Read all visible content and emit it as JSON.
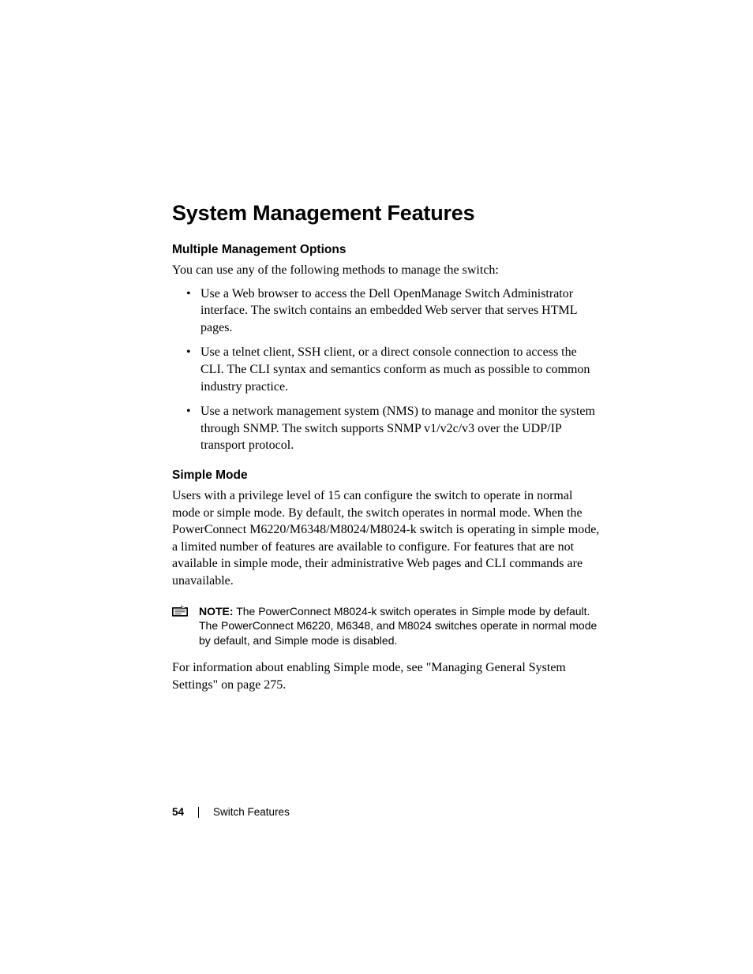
{
  "heading": "System Management Features",
  "section1": {
    "title": "Multiple Management Options",
    "intro": "You can use any of the following methods to manage the switch:",
    "bullets": [
      "Use a Web browser to access the Dell OpenManage Switch Administrator interface. The switch contains an embedded Web server that serves HTML pages.",
      "Use a telnet client, SSH client, or a direct console connection to access the CLI. The CLI syntax and semantics conform as much as possible to common industry practice.",
      "Use a network management system (NMS) to manage and monitor the system through SNMP. The switch supports SNMP v1/v2c/v3 over the UDP/IP transport protocol."
    ]
  },
  "section2": {
    "title": "Simple Mode",
    "body": "Users with a privilege level of 15 can configure the switch to operate in normal mode or simple mode. By default, the switch operates in normal mode. When the PowerConnect M6220/M6348/M8024/M8024-k switch is operating in simple mode, a limited number of features are available to configure. For features that are not available in simple mode, their administrative Web pages and CLI commands are unavailable.",
    "note_label": "NOTE:",
    "note_text": " The PowerConnect M8024-k switch operates in Simple mode by default. The PowerConnect M6220, M6348, and M8024 switches operate in normal mode by default, and Simple mode is disabled.",
    "after_note": "For information about enabling Simple mode, see \"Managing General System Settings\" on page 275."
  },
  "footer": {
    "page_number": "54",
    "section_name": "Switch Features"
  }
}
